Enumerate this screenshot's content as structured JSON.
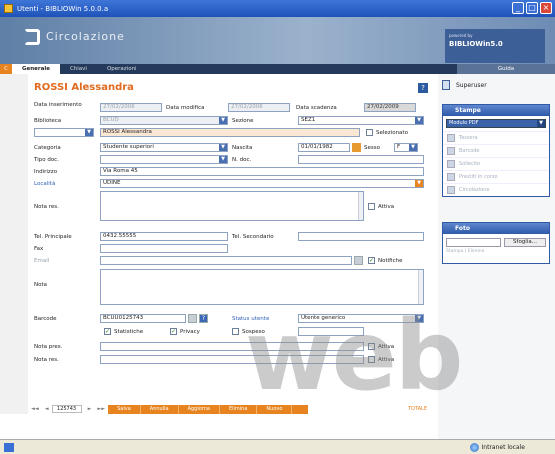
{
  "window": {
    "title": "Utenti - BIBLIOWin 5.0.0.a"
  },
  "banner": {
    "app_name": "Circolazione",
    "brand_small": "powered by",
    "brand_name": "BIBLIOWin5.0"
  },
  "tabs": [
    {
      "label": "Generale"
    },
    {
      "label": "Chiavi"
    },
    {
      "label": "Operazioni"
    }
  ],
  "tab_mark": "C",
  "guida_label": "Guida",
  "person": {
    "name": "ROSSI Alessandra"
  },
  "help_label": "?",
  "form": {
    "data_inserimento_label": "Data inserimento",
    "data_inserimento": "27/02/2006",
    "data_modifica_label": "Data modifica",
    "data_modifica": "27/02/2006",
    "data_scadenza_label": "Data scadenza",
    "data_scadenza": "27/02/2009",
    "biblioteca_label": "Biblioteca",
    "biblioteca": "BCUD",
    "sezione_label": "Sezione",
    "sezione": "SEZ1",
    "nome_completo": "ROSSI Alessandra",
    "selezionato_label": "Selezionato",
    "categoria_label": "Categoria",
    "categoria": "Studente superiori",
    "nascita_label": "Nascita",
    "nascita": "01/01/1982",
    "sesso_label": "Sesso",
    "sesso": "F",
    "tipo_doc_label": "Tipo doc.",
    "n_doc_label": "N. doc.",
    "indirizzo_label": "Indirizzo",
    "indirizzo": "Via Roma 45",
    "localita_label": "Località",
    "localita": "UDINE",
    "nota_res_label": "Nota res.",
    "attiva_label": "Attiva",
    "tel_principale_label": "Tel. Principale",
    "tel_principale": "0432.55555",
    "tel_secondario_label": "Tel. Secondario",
    "fax_label": "Fax",
    "email_label": "Email",
    "notifiche_label": "Notifiche",
    "nota_label": "Nota",
    "barcode_label": "Barcode",
    "barcode": "BCUU0125743",
    "status_label": "Status utente",
    "status": "Utente generico",
    "statistiche_label": "Statistiche",
    "privacy_label": "Privacy",
    "sospeso_label": "Sospeso",
    "nota_pres_label": "Nota pres.",
    "nota_res2_label": "Nota res."
  },
  "footer": {
    "nav_first": "◄◄",
    "nav_prev": "◄",
    "nav_next": "►",
    "nav_last": "►►",
    "record": "125743",
    "buttons": [
      "Salva",
      "Annulla",
      "Aggiorna",
      "Elimina",
      "Nuovo"
    ],
    "total": "TOTALE"
  },
  "side": {
    "superuser": "Superuser",
    "stampe_title": "Stampe",
    "stampe_select": "Modulo PDF",
    "stampe_items": [
      "Tessera",
      "Barcode",
      "Sollecito",
      "Prestiti in corso",
      "Circolazione"
    ],
    "foto_title": "Foto",
    "sfoglia": "Sfoglia...",
    "foto_links": "Stampa | Elimina"
  },
  "status": {
    "zone": "Intranet locale"
  },
  "watermark": "web"
}
